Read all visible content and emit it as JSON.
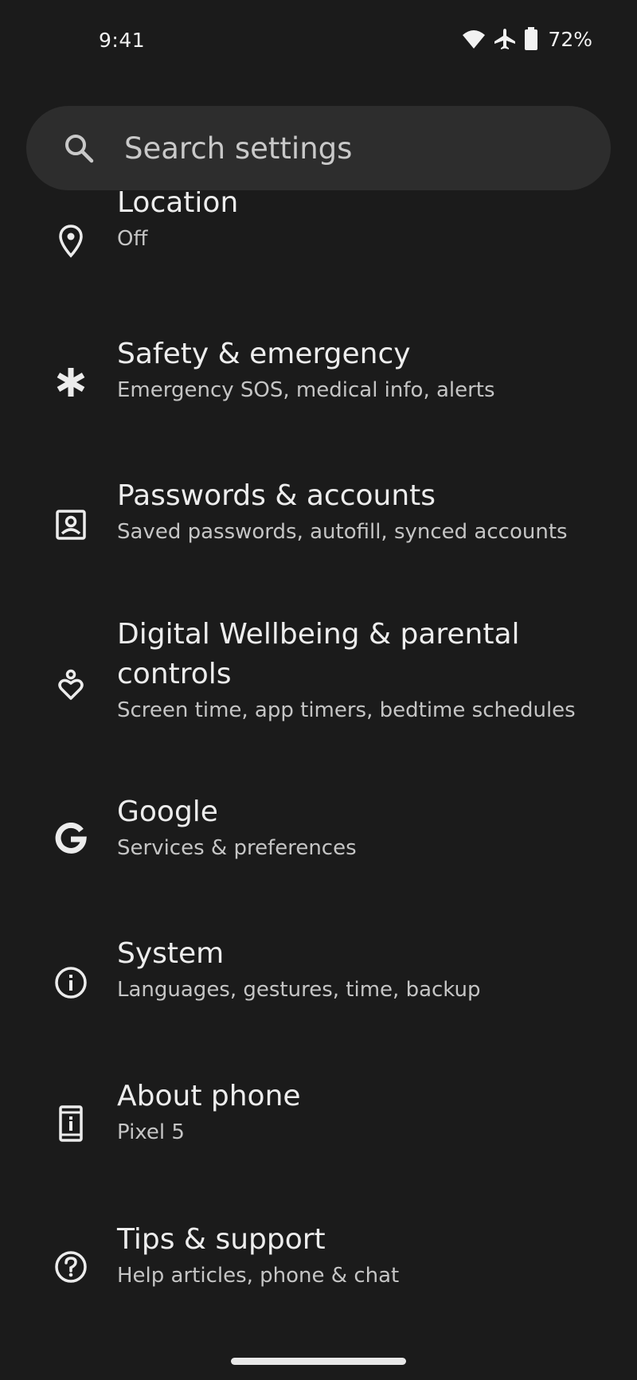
{
  "status_bar": {
    "time": "9:41",
    "battery_percent": "72%",
    "icons": [
      "wifi-icon",
      "airplane-mode-icon",
      "battery-icon"
    ]
  },
  "search": {
    "placeholder": "Search settings"
  },
  "settings": {
    "items": [
      {
        "title": "Location",
        "subtitle": "Off",
        "icon": "location-pin-icon"
      },
      {
        "title": "Safety & emergency",
        "subtitle": "Emergency SOS, medical info, alerts",
        "icon": "asterisk-icon"
      },
      {
        "title": "Passwords & accounts",
        "subtitle": "Saved passwords, autofill, synced accounts",
        "icon": "account-box-icon"
      },
      {
        "title": "Digital Wellbeing & parental controls",
        "subtitle": "Screen time, app timers, bedtime schedules",
        "icon": "wellbeing-icon"
      },
      {
        "title": "Google",
        "subtitle": "Services & preferences",
        "icon": "google-g-icon"
      },
      {
        "title": "System",
        "subtitle": "Languages, gestures, time, backup",
        "icon": "info-icon"
      },
      {
        "title": "About phone",
        "subtitle": "Pixel 5",
        "icon": "phone-info-icon"
      },
      {
        "title": "Tips & support",
        "subtitle": "Help articles, phone & chat",
        "icon": "help-icon"
      }
    ]
  },
  "colors": {
    "background": "#1b1b1b",
    "search_bar": "#2d2d2d",
    "primary_text": "#ededed",
    "secondary_text": "#c5c5c5"
  }
}
